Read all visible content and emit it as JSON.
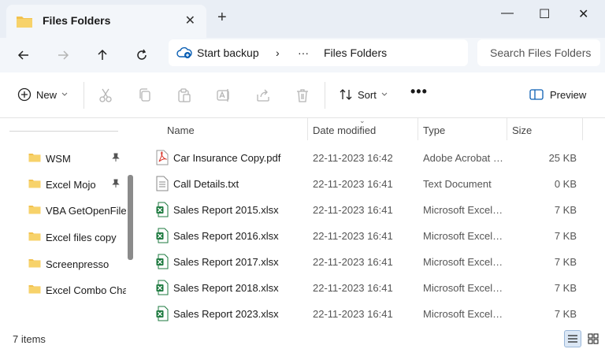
{
  "window": {
    "tab_title": "Files Folders",
    "tab_close": "✕",
    "new_tab": "+",
    "minimize": "—",
    "maximize": "☐",
    "close": "✕"
  },
  "address": {
    "root": "Start backup",
    "separator": "›",
    "ellipsis": "···",
    "current": "Files Folders",
    "search_placeholder": "Search Files Folders"
  },
  "toolbar": {
    "new_label": "New",
    "sort_label": "Sort",
    "more": "•••",
    "preview_label": "Preview"
  },
  "sidebar": {
    "items": [
      {
        "label": "WSM",
        "pinned": true
      },
      {
        "label": "Excel Mojo",
        "pinned": true
      },
      {
        "label": "VBA GetOpenFileName",
        "pinned": false
      },
      {
        "label": "Excel files copy",
        "pinned": false
      },
      {
        "label": "Screenpresso",
        "pinned": false
      },
      {
        "label": "Excel Combo Chart",
        "pinned": false
      }
    ]
  },
  "columns": {
    "name": "Name",
    "date": "Date modified",
    "type": "Type",
    "size": "Size"
  },
  "files": [
    {
      "name": "Car Insurance Copy.pdf",
      "date": "22-11-2023 16:42",
      "type": "Adobe Acrobat Document",
      "size": "25 KB",
      "icon": "pdf-icon"
    },
    {
      "name": "Call Details.txt",
      "date": "22-11-2023 16:41",
      "type": "Text Document",
      "size": "0 KB",
      "icon": "txt-icon"
    },
    {
      "name": "Sales Report 2015.xlsx",
      "date": "22-11-2023 16:41",
      "type": "Microsoft Excel Worksheet",
      "size": "7 KB",
      "icon": "excel-icon"
    },
    {
      "name": "Sales Report 2016.xlsx",
      "date": "22-11-2023 16:41",
      "type": "Microsoft Excel Worksheet",
      "size": "7 KB",
      "icon": "excel-icon"
    },
    {
      "name": "Sales Report 2017.xlsx",
      "date": "22-11-2023 16:41",
      "type": "Microsoft Excel Worksheet",
      "size": "7 KB",
      "icon": "excel-icon"
    },
    {
      "name": "Sales Report 2018.xlsx",
      "date": "22-11-2023 16:41",
      "type": "Microsoft Excel Worksheet",
      "size": "7 KB",
      "icon": "excel-icon"
    },
    {
      "name": "Sales Report 2023.xlsx",
      "date": "22-11-2023 16:41",
      "type": "Microsoft Excel Worksheet",
      "size": "7 KB",
      "icon": "excel-icon"
    }
  ],
  "status": {
    "item_count": "7 items"
  },
  "colors": {
    "folder": "#f2c14e",
    "excel": "#1d7a3f",
    "pdf": "#d93025",
    "accent": "#0a5fb4"
  }
}
